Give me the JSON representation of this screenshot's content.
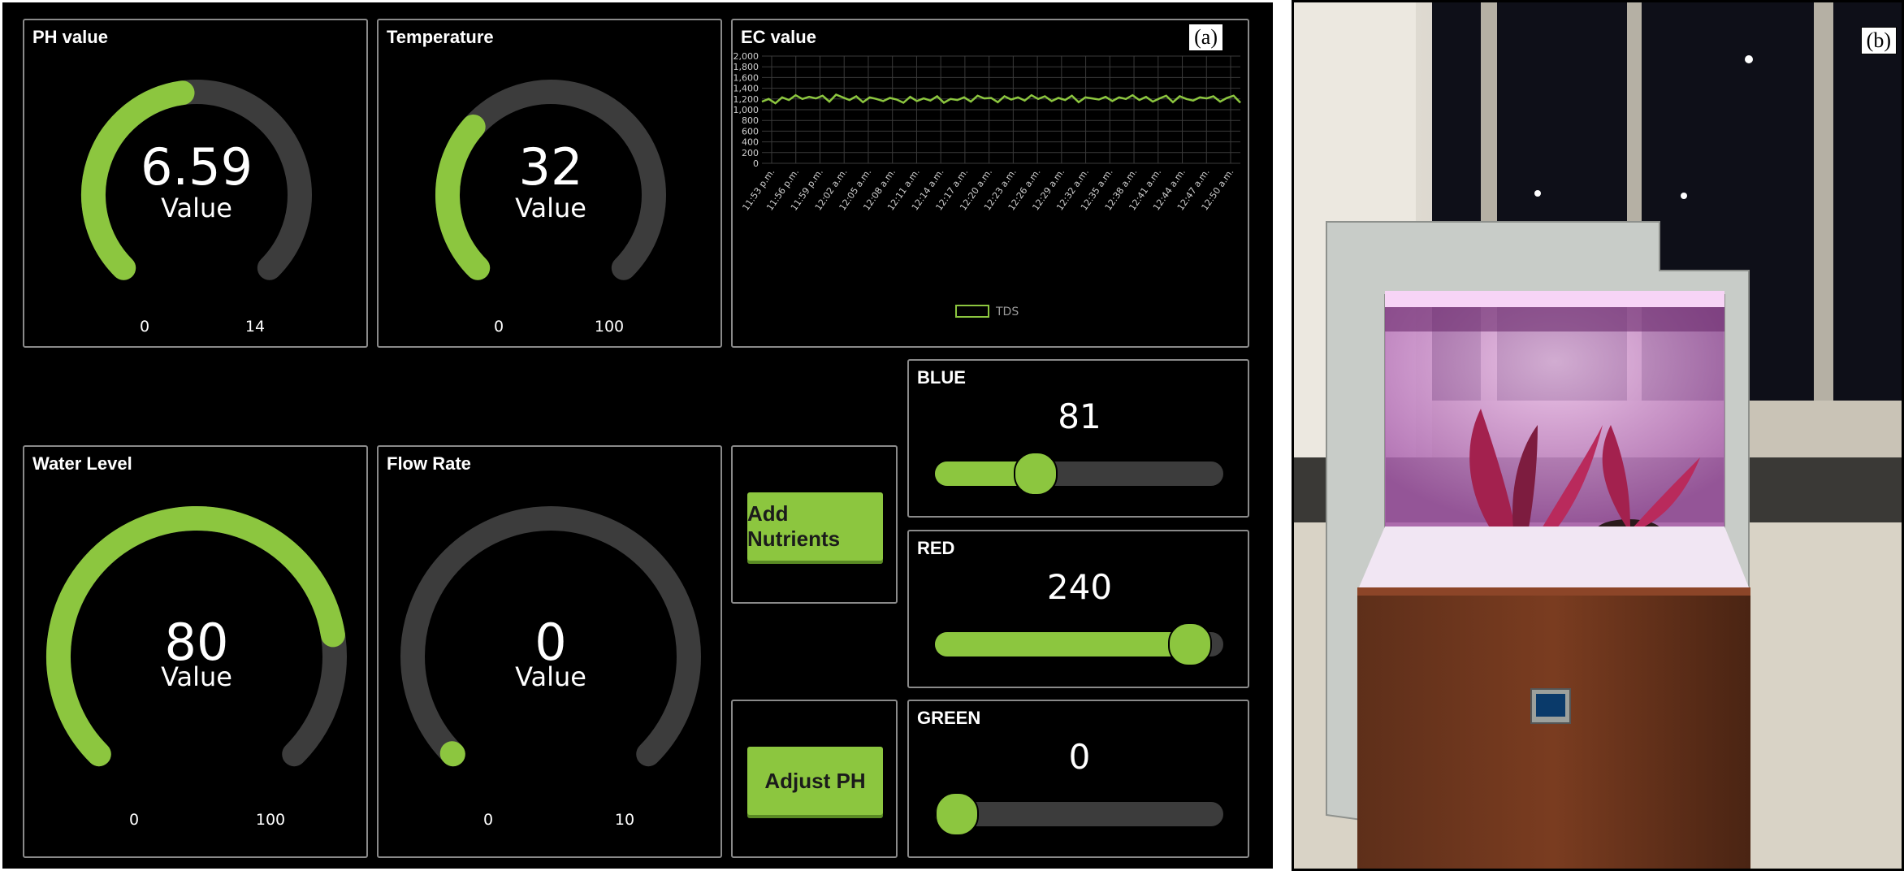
{
  "labels": {
    "a": "(a)",
    "b": "(b)"
  },
  "colors": {
    "accent": "#8cc63f",
    "track": "#3c3c3c",
    "background": "#000000",
    "panel_border": "#8a8a8a"
  },
  "gauges": {
    "ph": {
      "title": "PH value",
      "value": "6.59",
      "sub": "Value",
      "min": "0",
      "max": "14",
      "num": 6.59,
      "lo": 0,
      "hi": 14
    },
    "temp": {
      "title": "Temperature",
      "value": "32",
      "sub": "Value",
      "min": "0",
      "max": "100",
      "num": 32,
      "lo": 0,
      "hi": 100
    },
    "water": {
      "title": "Water Level",
      "value": "80",
      "sub": "Value",
      "min": "0",
      "max": "100",
      "num": 80,
      "lo": 0,
      "hi": 100
    },
    "flow": {
      "title": "Flow Rate",
      "value": "0",
      "sub": "Value",
      "min": "0",
      "max": "10",
      "num": 0,
      "lo": 0,
      "hi": 10
    }
  },
  "ec": {
    "title": "EC value",
    "legend": "TDS"
  },
  "buttons": {
    "nutrients": "Add Nutrients",
    "ph": "Adjust PH"
  },
  "sliders": {
    "blue": {
      "title": "BLUE",
      "value": "81",
      "num": 81,
      "max": 255
    },
    "red": {
      "title": "RED",
      "value": "240",
      "num": 240,
      "max": 255
    },
    "green": {
      "title": "GREEN",
      "value": "0",
      "num": 0,
      "max": 255
    }
  },
  "chart_data": {
    "type": "line",
    "title": "EC value",
    "ylim": [
      0,
      2000
    ],
    "yticks": [
      "0",
      "200",
      "400",
      "600",
      "800",
      "1,000",
      "1,200",
      "1,400",
      "1,600",
      "1,800",
      "2,000"
    ],
    "xticks": [
      "11:53 p.m.",
      "11:56 p.m.",
      "11:59 p.m.",
      "12:02 a.m.",
      "12:05 a.m.",
      "12:08 a.m.",
      "12:11 a.m.",
      "12:14 a.m.",
      "12:17 a.m.",
      "12:20 a.m.",
      "12:23 a.m.",
      "12:26 a.m.",
      "12:29 a.m.",
      "12:32 a.m.",
      "12:35 a.m.",
      "12:38 a.m.",
      "12:41 a.m.",
      "12:44 a.m.",
      "12:47 a.m.",
      "12:50 a.m."
    ],
    "grid": true,
    "legend_position": "bottom",
    "series": [
      {
        "name": "TDS",
        "values": [
          1150,
          1200,
          1120,
          1230,
          1180,
          1270,
          1200,
          1240,
          1210,
          1260,
          1150,
          1280,
          1230,
          1180,
          1250,
          1140,
          1230,
          1200,
          1160,
          1220,
          1190,
          1130,
          1240,
          1160,
          1210,
          1170,
          1250,
          1130,
          1200,
          1180,
          1230,
          1150,
          1260,
          1210,
          1220,
          1140,
          1250,
          1190,
          1230,
          1170,
          1270,
          1200,
          1250,
          1160,
          1220,
          1180,
          1260,
          1140,
          1230,
          1210,
          1190,
          1240,
          1160,
          1230,
          1200,
          1270,
          1180,
          1240,
          1150,
          1210,
          1260,
          1140,
          1250,
          1200,
          1170,
          1230,
          1210,
          1250,
          1150,
          1220,
          1260,
          1130
        ]
      }
    ]
  }
}
